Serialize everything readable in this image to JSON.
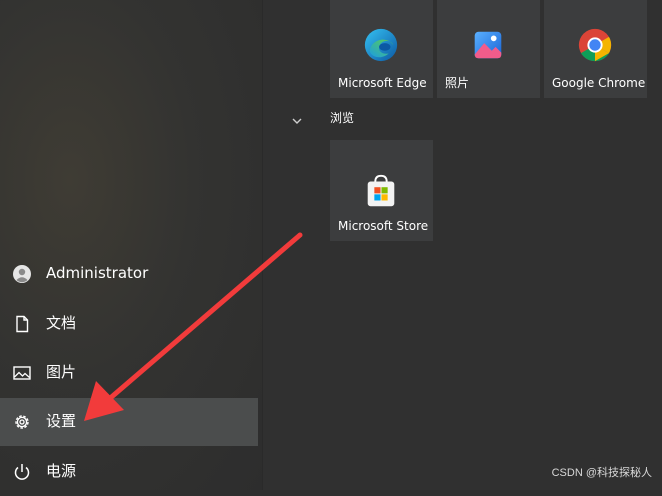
{
  "tiles": [
    {
      "label": "Microsoft Edge",
      "icon": "edge-icon"
    },
    {
      "label": "照片",
      "icon": "photos-icon"
    },
    {
      "label": "Google Chrome",
      "icon": "chrome-icon"
    },
    {
      "label": "Microsoft Store",
      "icon": "store-icon"
    }
  ],
  "group_header": "浏览",
  "nav": {
    "user": "Administrator",
    "documents": "文档",
    "pictures": "图片",
    "settings": "设置",
    "power": "电源"
  },
  "watermark": "CSDN @科技探秘人",
  "colors": {
    "arrow": "#f23b3b",
    "active_bg": "#4b4d4d"
  }
}
